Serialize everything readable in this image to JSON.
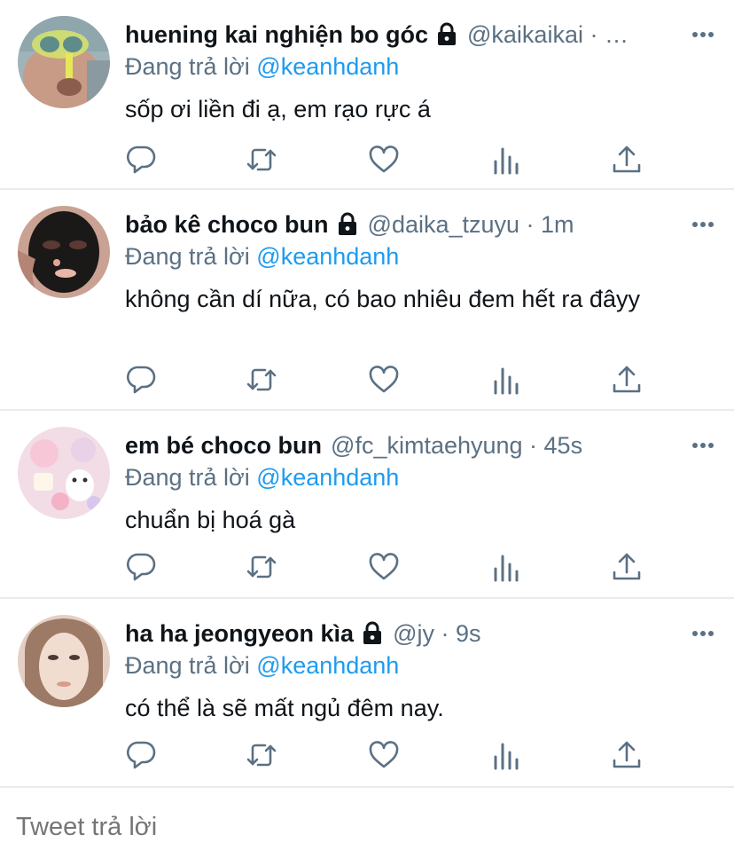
{
  "tweets": [
    {
      "name": "huening kai nghiện bo góc",
      "locked": true,
      "handle": "@kaikaikai · …",
      "reply_prefix": "Đang trả lời",
      "reply_to": "@keanhdanh",
      "text": "sốp ơi liền đi ạ, em rạo rực á"
    },
    {
      "name": "bảo kê choco bun",
      "locked": true,
      "handle": "@daika_tzuyu · 1m",
      "reply_prefix": "Đang trả lời",
      "reply_to": "@keanhdanh",
      "text": "không cần dí nữa, có bao nhiêu đem hết ra đâyy"
    },
    {
      "name": "em bé choco bun",
      "locked": false,
      "handle": "@fc_kimtaehyung · 45s",
      "reply_prefix": "Đang trả lời",
      "reply_to": "@keanhdanh",
      "text": "chuẩn bị hoá gà"
    },
    {
      "name": "ha ha jeongyeon kìa",
      "locked": true,
      "handle": "@jy · 9s",
      "reply_prefix": "Đang trả lời",
      "reply_to": "@keanhdanh",
      "text": "có thể là sẽ mất ngủ đêm nay."
    }
  ],
  "icons": {
    "more": "more-dots-icon",
    "lock": "lock-icon",
    "reply": "reply-icon",
    "retweet": "retweet-icon",
    "like": "heart-icon",
    "analytics": "analytics-icon",
    "share": "share-icon"
  },
  "colors": {
    "link": "#1d9bf0",
    "secondary": "#5b7083",
    "icon": "#5b7083",
    "divider": "#e6ecf0",
    "placeholder": "#b4bec7"
  },
  "compose": {
    "placeholder": "Tweet trả lời"
  }
}
